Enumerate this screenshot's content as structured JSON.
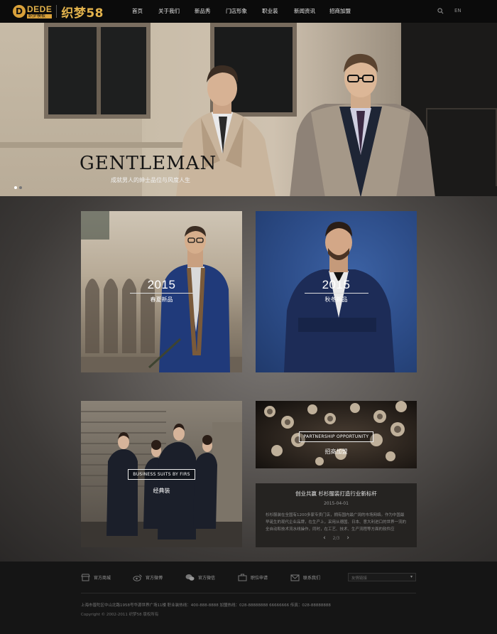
{
  "header": {
    "logo": {
      "mark": "D",
      "dede": "DEDE",
      "sub": "织梦模板",
      "brand": "织梦58"
    },
    "nav": [
      {
        "label": "首页"
      },
      {
        "label": "关于我们"
      },
      {
        "label": "新品秀"
      },
      {
        "label": "门店形象"
      },
      {
        "label": "职业装"
      },
      {
        "label": "新闻资讯"
      },
      {
        "label": "招商加盟"
      }
    ],
    "search_icon": "search-icon",
    "lang_label": "EN"
  },
  "hero": {
    "title": "GENTLEMAN",
    "subtitle": "成就男人的绅士品位与风度人生",
    "slides": 2,
    "active_slide": 1
  },
  "tiles": {
    "t1": {
      "year": "2015",
      "season": "春夏新品"
    },
    "t2": {
      "year": "2015",
      "season": "秋冬新品"
    },
    "t3": {
      "boxed": "BUSINESS SUITS BY FIRS",
      "label": "经典装"
    },
    "t4": {
      "boxed": "PARTNERSHIP OPPORTUNITY",
      "label": "招商加盟"
    }
  },
  "news": {
    "title": "创业共赢 杉杉服装打造行业新标杆",
    "date": "2015-04-01",
    "text": "杉杉服装在全国有1200多家专卖门店，拥有国内最广阔的市场网络。作为中国最早诞生的现代企业品牌，在生产上，采用从德国、日本、意大利进口的世界一流的全自动和技术流水线操作，同时，在工艺、技术、生产流程等方面的软件应",
    "pager": "2/3",
    "prev": "‹",
    "next": "›"
  },
  "footer": {
    "links": [
      {
        "label": "官方商城",
        "icon": "shop-icon"
      },
      {
        "label": "官方微博",
        "icon": "weibo-icon"
      },
      {
        "label": "官方微信",
        "icon": "wechat-icon"
      },
      {
        "label": "职位申请",
        "icon": "job-icon"
      },
      {
        "label": "联系我们",
        "icon": "mail-icon"
      }
    ],
    "select_placeholder": "友情链接",
    "address": "上海市普陀区中山北路1958号华源世界广场11楼 职业装热线：400-888-8888 加盟热线：028-88888888 66666666 传真：028-88888888",
    "copyright": "Copyright © 2002-2011 织梦58 版权所有"
  },
  "colors": {
    "accent": "#d9a13a",
    "header_bg": "#0b0b0b",
    "footer_bg": "#151515"
  }
}
